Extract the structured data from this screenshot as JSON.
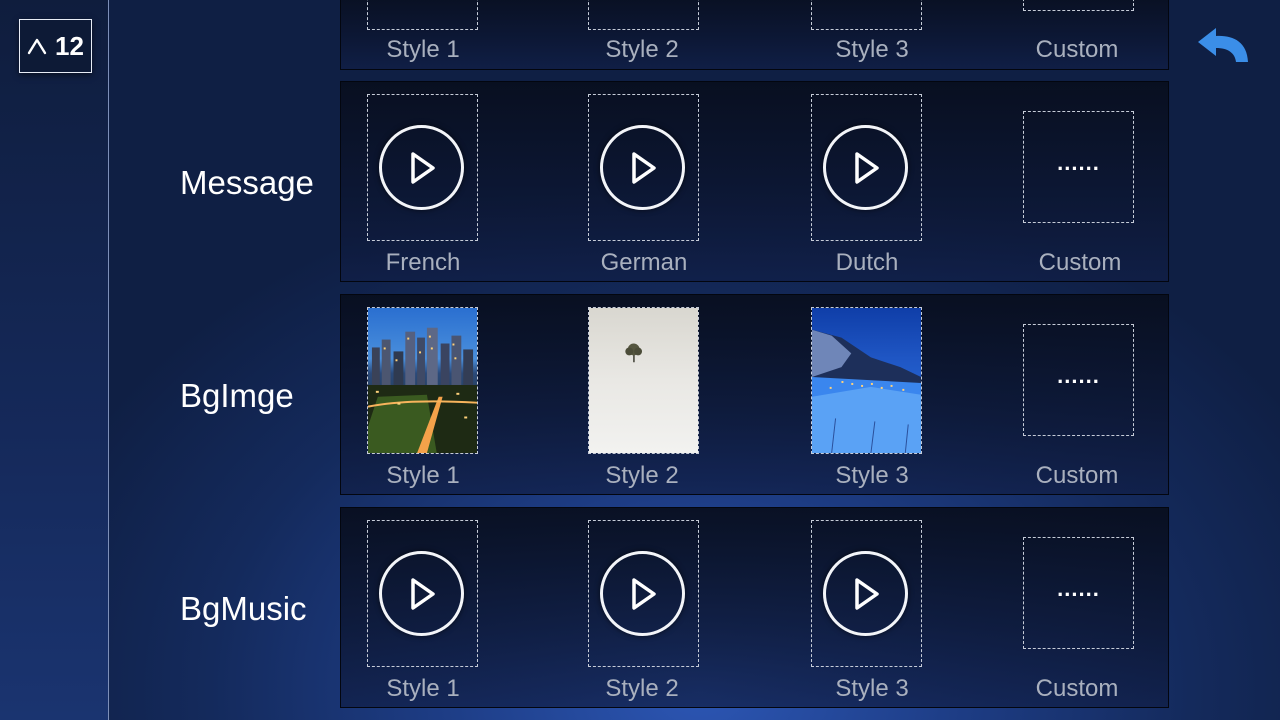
{
  "page_indicator": {
    "number": "12"
  },
  "rows": {
    "top": {
      "captions": [
        "Style 1",
        "Style 2",
        "Style 3",
        "Custom"
      ]
    },
    "message": {
      "label": "Message",
      "captions": [
        "French",
        "German",
        "Dutch",
        "Custom"
      ],
      "custom_placeholder": "......"
    },
    "bgimage": {
      "label": "BgImge",
      "captions": [
        "Style 1",
        "Style 2",
        "Style 3",
        "Custom"
      ],
      "thumbnails": [
        "city-night-skyline-image",
        "lone-tree-snow-image",
        "snowy-mountain-village-image"
      ],
      "custom_placeholder": "......"
    },
    "bgmusic": {
      "label": "BgMusic",
      "captions": [
        "Style 1",
        "Style 2",
        "Style 3",
        "Custom"
      ],
      "custom_placeholder": "......"
    }
  },
  "icons": {
    "page_up": "caret-up-icon",
    "back": "back-arrow-icon",
    "play": "play-icon"
  },
  "colors": {
    "accent": "#3b8ee8",
    "text": "#ffffff",
    "caption": "#a9b0be",
    "border": "#c6ccd8"
  }
}
